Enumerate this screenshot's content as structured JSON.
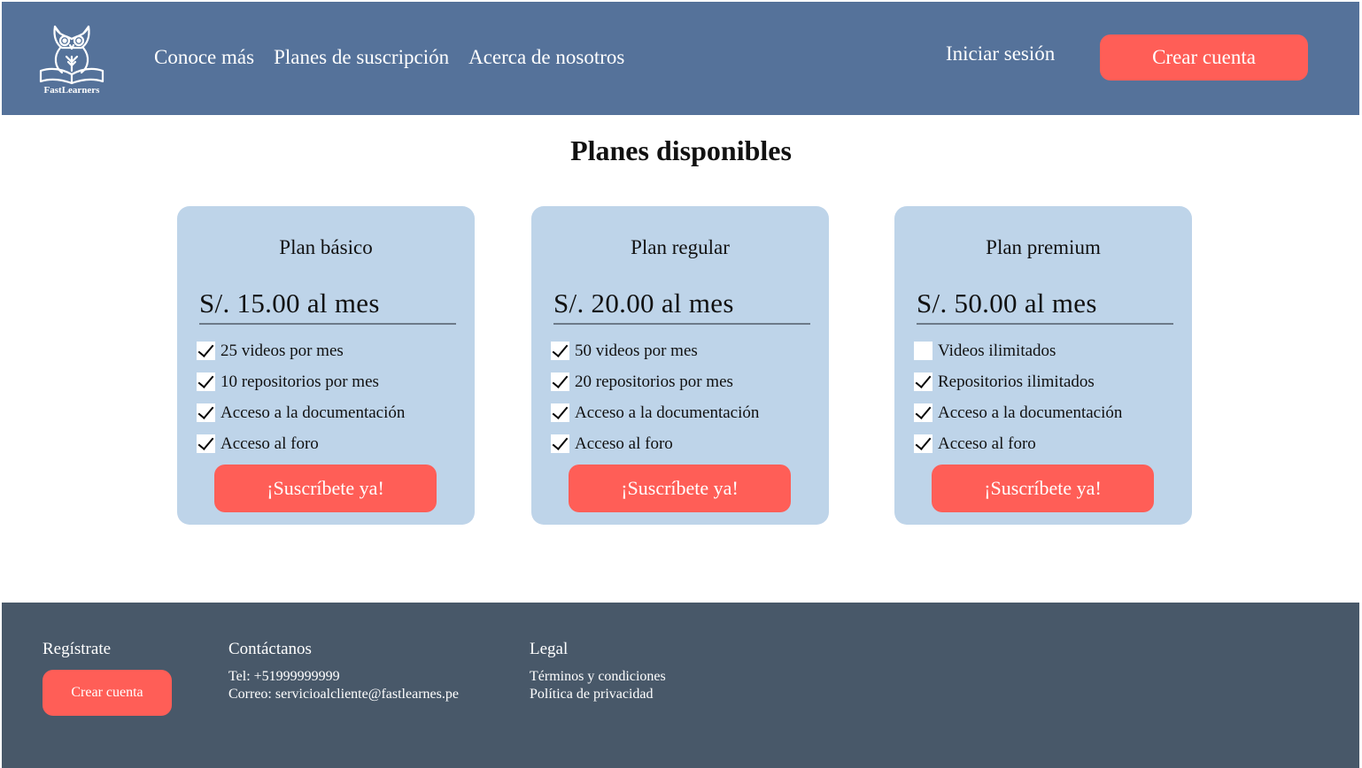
{
  "brand": {
    "name": "FastLearners"
  },
  "nav": {
    "items": [
      "Conoce más",
      "Planes de suscripción",
      "Acerca de nosotros"
    ],
    "login": "Iniciar sesión",
    "create_account": "Crear cuenta"
  },
  "main": {
    "title": "Planes disponibles"
  },
  "plans": [
    {
      "name": "Plan básico",
      "price": "S/. 15.00 al mes",
      "features": [
        {
          "label": "25 videos por mes",
          "checked": true
        },
        {
          "label": "10 repositorios por mes",
          "checked": true
        },
        {
          "label": "Acceso a la documentación",
          "checked": true
        },
        {
          "label": "Acceso al foro",
          "checked": true
        }
      ],
      "cta": "¡Suscríbete ya!"
    },
    {
      "name": "Plan regular",
      "price": "S/. 20.00 al mes",
      "features": [
        {
          "label": "50 videos por mes",
          "checked": true
        },
        {
          "label": "20 repositorios por mes",
          "checked": true
        },
        {
          "label": "Acceso a la documentación",
          "checked": true
        },
        {
          "label": "Acceso al foro",
          "checked": true
        }
      ],
      "cta": "¡Suscríbete ya!"
    },
    {
      "name": "Plan premium",
      "price": "S/. 50.00 al mes",
      "features": [
        {
          "label": "Videos ilimitados",
          "checked": false
        },
        {
          "label": "Repositorios ilimitados",
          "checked": true
        },
        {
          "label": "Acceso a la documentación",
          "checked": true
        },
        {
          "label": "Acceso al foro",
          "checked": true
        }
      ],
      "cta": "¡Suscríbete ya!"
    }
  ],
  "footer": {
    "register": {
      "heading": "Regístrate",
      "button": "Crear cuenta"
    },
    "contact": {
      "heading": "Contáctanos",
      "phone": "Tel: +51999999999",
      "email": "Correo: servicioalcliente@fastlearnes.pe"
    },
    "legal": {
      "heading": "Legal",
      "terms": "Términos y condiciones",
      "privacy": "Política de privacidad"
    }
  },
  "colors": {
    "header": "#55729a",
    "accent": "#ff5e57",
    "card": "#bed4e9",
    "footer": "#485869"
  },
  "icons": {
    "logo": "owl-book-icon",
    "check": "checkmark-icon"
  }
}
